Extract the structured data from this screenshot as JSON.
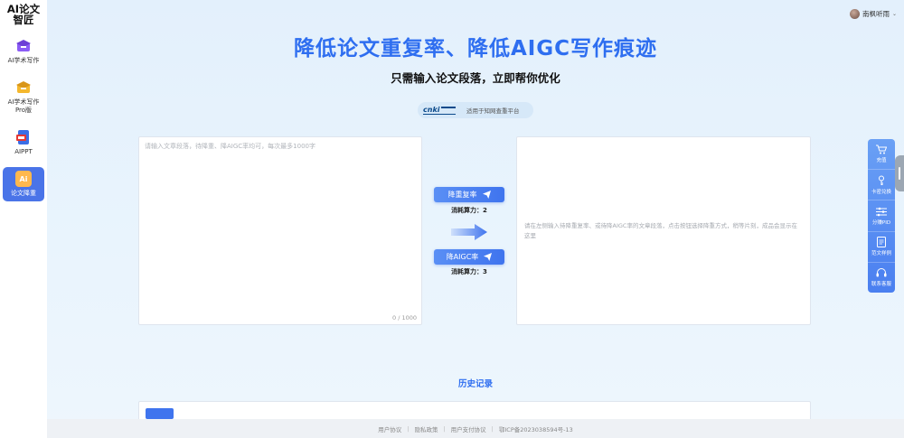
{
  "sidebar": {
    "logo_line1": "AI论文",
    "logo_line2": "智匠",
    "items": [
      {
        "label": "AI学术写作"
      },
      {
        "label": "AI学术写作Pro版"
      },
      {
        "label": "AIPPT"
      },
      {
        "label": "论文降重"
      }
    ]
  },
  "user": {
    "name": "南枫听雨"
  },
  "hero": {
    "title": "降低论文重复率、降低AIGC写作痕迹",
    "subtitle": "只需输入论文段落，立即帮你优化",
    "platform_text": "适用于知网查重平台"
  },
  "input": {
    "placeholder": "请输入文章段落，待降重、降AIGC率均可，每次最多1000字",
    "value": "",
    "counter": "0 / 1000"
  },
  "output": {
    "placeholder": "请在左侧输入待降重复率、或待降AIGC率的文章段落，点击按钮选择降重方式，稍等片刻，成品会显示在这里"
  },
  "actions": {
    "reduce_repeat": {
      "label": "降重复率",
      "cost": "消耗算力：2"
    },
    "reduce_aigc": {
      "label": "降AIGC率",
      "cost": "消耗算力：3"
    }
  },
  "history": {
    "title": "历史记录"
  },
  "tools": [
    {
      "label": "充值",
      "icon": "cart-icon"
    },
    {
      "label": "卡密兑换",
      "icon": "key-icon"
    },
    {
      "label": "分赚PID",
      "icon": "sliders-icon"
    },
    {
      "label": "范文样例",
      "icon": "document-icon"
    },
    {
      "label": "联系客服",
      "icon": "headset-icon"
    }
  ],
  "footer": {
    "links": [
      "用户协议",
      "隐私政策",
      "用户支付协议"
    ],
    "icp": "鄂ICP备2023038594号-13"
  },
  "colors": {
    "accent": "#2e6ef0",
    "button": "#3f74ee",
    "active_nav": "#4a74e8"
  }
}
